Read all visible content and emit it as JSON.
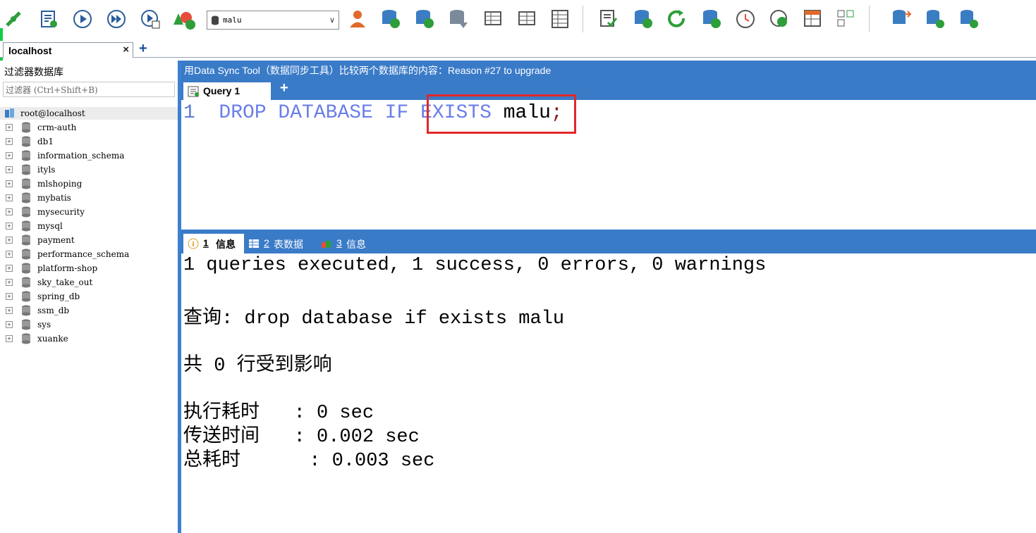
{
  "toolbar": {
    "db_selector_value": "malu",
    "icons": [
      "connect-icon",
      "new-query-icon",
      "execute-icon",
      "execute-all-icon",
      "execute-edit-icon",
      "schema-designer-icon",
      "db-dropdown",
      "user-manager-icon",
      "db-copy-icon",
      "db-sync-icon",
      "schema-sync-icon",
      "table-data-icon",
      "table-diff-icon",
      "grid-icon",
      "sql-log-icon",
      "backup-icon",
      "refresh-icon",
      "import-icon",
      "scheduler-icon",
      "job-icon",
      "report-icon",
      "query-builder-icon",
      "db-compare-icon",
      "db-sync2-icon",
      "db-sync3-icon"
    ]
  },
  "connection_tab": {
    "label": "localhost",
    "close": "×",
    "add": "+"
  },
  "sidebar": {
    "title": "过滤器数据库",
    "filter_placeholder": "过滤器 (Ctrl+Shift+B)",
    "root": "root@localhost",
    "databases": [
      "crm-auth",
      "db1",
      "information_schema",
      "ityls",
      "mlshoping",
      "mybatis",
      "mysecurity",
      "mysql",
      "payment",
      "performance_schema",
      "platform-shop",
      "sky_take_out",
      "spring_db",
      "ssm_db",
      "sys",
      "xuanke"
    ]
  },
  "main": {
    "banner": "用Data Sync Tool（数据同步工具）比较两个数据库的内容：Reason #27 to upgrade",
    "query_tab": "Query 1",
    "query_add": "+",
    "editor": {
      "line_number": "1",
      "kw1": "DROP DATABASE",
      "kw2": "IF EXISTS",
      "name": "malu",
      "semicolon": ";"
    },
    "result_tabs": [
      {
        "num": "1",
        "label": "信息"
      },
      {
        "num": "2",
        "label": "表数据"
      },
      {
        "num": "3",
        "label": "信息"
      }
    ],
    "output": {
      "summary": "1 queries executed, 1 success, 0 errors, 0 warnings",
      "query_line": "查询: drop database if exists malu",
      "affected": "共 0 行受到影响",
      "exec_time": "执行耗时   : 0 sec",
      "transfer_time": "传送时间   : 0.002 sec",
      "total_time": "总耗时      : 0.003 sec"
    }
  },
  "colors": {
    "accent_blue": "#3a7bc8",
    "highlight_red": "#e22727",
    "keyword": "#6a7ee8"
  }
}
